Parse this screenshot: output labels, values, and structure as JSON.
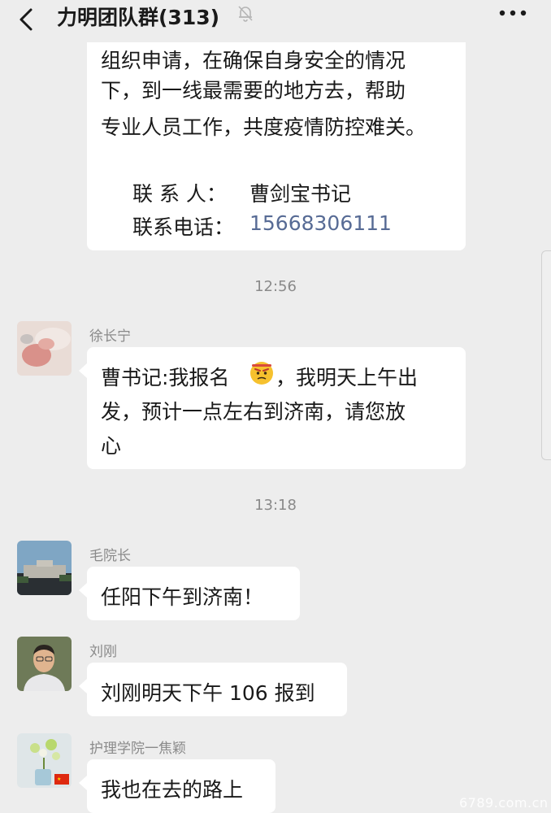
{
  "header": {
    "title": "力明团队群(313)"
  },
  "messages": {
    "notice": {
      "line1": "组织申请，在确保自身安全的情况",
      "line2": "下，到一线最需要的地方去，帮助",
      "line3": "专业人员工作，共度疫情防控难关。",
      "contact_label": "联 系 人：",
      "contact_value": "曹剑宝书记",
      "phone_label": "联系电话：",
      "phone_value": "15668306111"
    },
    "time1": "12:56",
    "msg1": {
      "sender": "徐长宁",
      "line1a": "曹书记:我报名",
      "line1b": "，我明天上午出",
      "line2": "发，预计一点左右到济南，请您放",
      "line3": "心"
    },
    "time2": "13:18",
    "msg2": {
      "sender": "毛院长",
      "text": "任阳下午到济南！"
    },
    "msg3": {
      "sender": "刘刚",
      "text": "刘刚明天下午 106 报到"
    },
    "msg4": {
      "sender": "护理学院一焦颖",
      "text": "我也在去的路上"
    }
  },
  "icons": {
    "back": "chevron-left-icon",
    "mute": "bell-muted-icon",
    "more": "more-dots-icon",
    "emoji": "grumpy-face-emoji-icon"
  },
  "watermark": "6789.com.cn",
  "colors": {
    "background": "#ededed",
    "bubble": "#ffffff",
    "link": "#576b95",
    "meta_text": "#8a8a8a"
  }
}
